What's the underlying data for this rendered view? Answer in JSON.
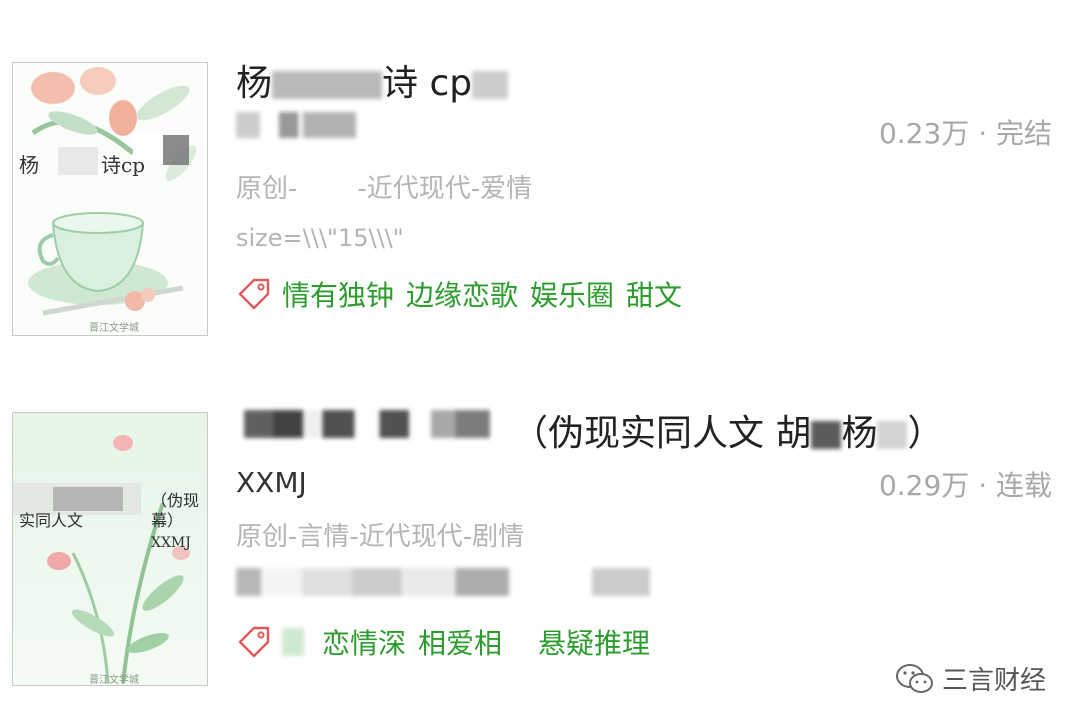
{
  "entries": [
    {
      "title_prefix": "杨",
      "title_suffix": "诗 cp",
      "stats": "0.23万 · 完结",
      "category_prefix": "原创-",
      "category_suffix": "-近代现代-爱情",
      "description": "size=\\\\\\\"15\\\\\\\"",
      "tags": [
        "情有独钟",
        "边缘恋歌",
        "娱乐圈",
        "甜文"
      ],
      "cover": {
        "title_a": "杨",
        "title_b": "诗cp",
        "watermark": "晋江文学城"
      }
    },
    {
      "title_suffix": "（伪现实同人文 胡",
      "title_mid": "杨",
      "title_end": "）",
      "author": "XXMJ",
      "stats": "0.29万 · 连载",
      "category": "原创-言情-近代现代-剧情",
      "tags": [
        "恋情深",
        "相爱相",
        "悬疑推理"
      ],
      "cover": {
        "line1": "（伪现",
        "line2": "幕）",
        "line3": "实同人文",
        "author": "XXMJ",
        "watermark": "晋江文学城"
      }
    }
  ],
  "watermark": {
    "text": "三言财经",
    "icon": "wechat-icon"
  },
  "colors": {
    "tag_green": "#2c9d2c",
    "tag_icon_red": "#e05a5a",
    "muted_gray": "#b4b4b4"
  }
}
